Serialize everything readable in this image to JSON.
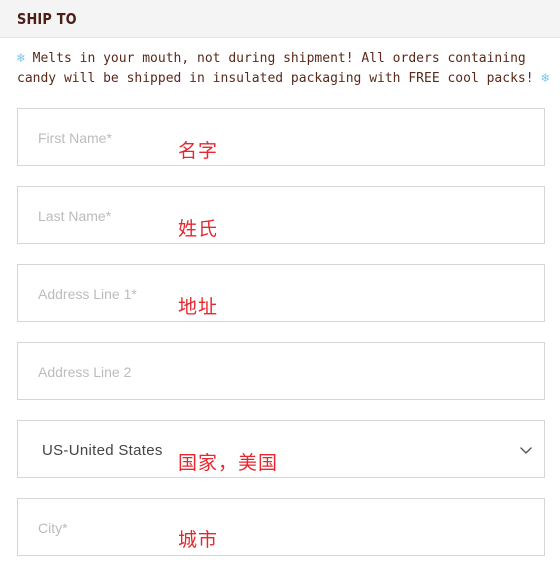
{
  "section": {
    "title": "SHIP TO",
    "notice_text": "Melts in your mouth, not during shipment! All orders containing candy will be shipped in insulated packaging with FREE cool packs!",
    "snow_icon": "snowflake-icon"
  },
  "form": {
    "first_name": {
      "placeholder": "First Name*",
      "annotation": "名字"
    },
    "last_name": {
      "placeholder": "Last Name*",
      "annotation": "姓氏"
    },
    "address1": {
      "placeholder": "Address Line 1*",
      "annotation": "地址"
    },
    "address2": {
      "placeholder": "Address Line 2"
    },
    "country": {
      "value": "US-United States",
      "annotation": "国家，美国",
      "icon": "chevron-down-icon"
    },
    "city": {
      "placeholder": "City*",
      "annotation": "城市"
    }
  },
  "colors": {
    "title": "#4a1e14",
    "notice": "#5a2a1a",
    "annotation": "#e8262e",
    "placeholder": "#bcbcbc",
    "border": "#d6d6d6",
    "snowflake": "#7fc4e8"
  }
}
